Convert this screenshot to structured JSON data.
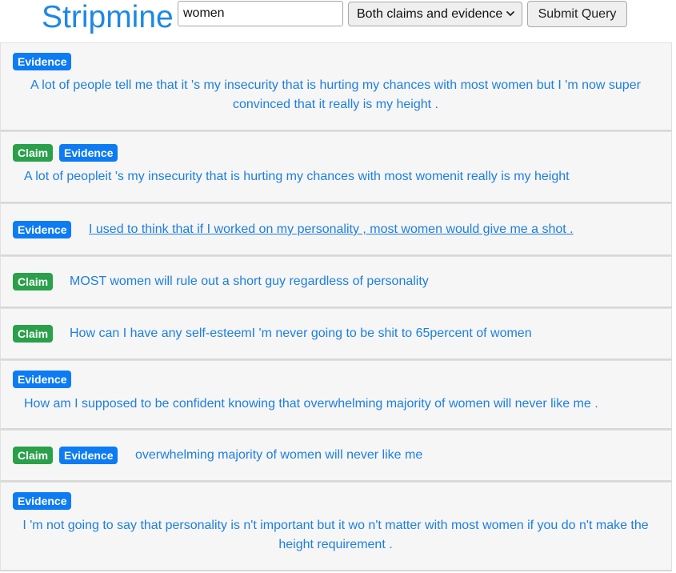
{
  "app": {
    "title": "Stripmine"
  },
  "search": {
    "value": "women"
  },
  "filter": {
    "selected": "Both claims and evidence"
  },
  "submit": {
    "label": "Submit Query"
  },
  "labels": {
    "claim": "Claim",
    "evidence": "Evidence"
  },
  "colors": {
    "accent": "#1e88e5",
    "evidence_badge": "#0d7bf3",
    "claim_badge": "#2aa04a",
    "card_background": "#f6f6f6"
  },
  "results": [
    {
      "badges": [
        "Evidence"
      ],
      "text": "A lot of people tell me that it 's my insecurity that is hurting my chances with most women but I 'm now super convinced that it really is my height ."
    },
    {
      "badges": [
        "Claim",
        "Evidence"
      ],
      "text": "A lot of peopleit 's my insecurity that is hurting my chances with most womenit really is my height"
    },
    {
      "badges": [
        "Evidence"
      ],
      "text": "I used to think that if I worked on my personality , most women would give me a shot ."
    },
    {
      "badges": [
        "Claim"
      ],
      "text": "MOST women will rule out a short guy regardless of personality"
    },
    {
      "badges": [
        "Claim"
      ],
      "text": "How can I have any self-esteemI 'm never going to be shit to 65percent of women"
    },
    {
      "badges": [
        "Evidence"
      ],
      "text": "How am I supposed to be confident knowing that overwhelming majority of women will never like me ."
    },
    {
      "badges": [
        "Claim",
        "Evidence"
      ],
      "text": "overwhelming majority of women will never like me"
    },
    {
      "badges": [
        "Evidence"
      ],
      "text": "I 'm not going to say that personality is n't important but it wo n't matter with most women if you do n't make the height requirement ."
    }
  ]
}
